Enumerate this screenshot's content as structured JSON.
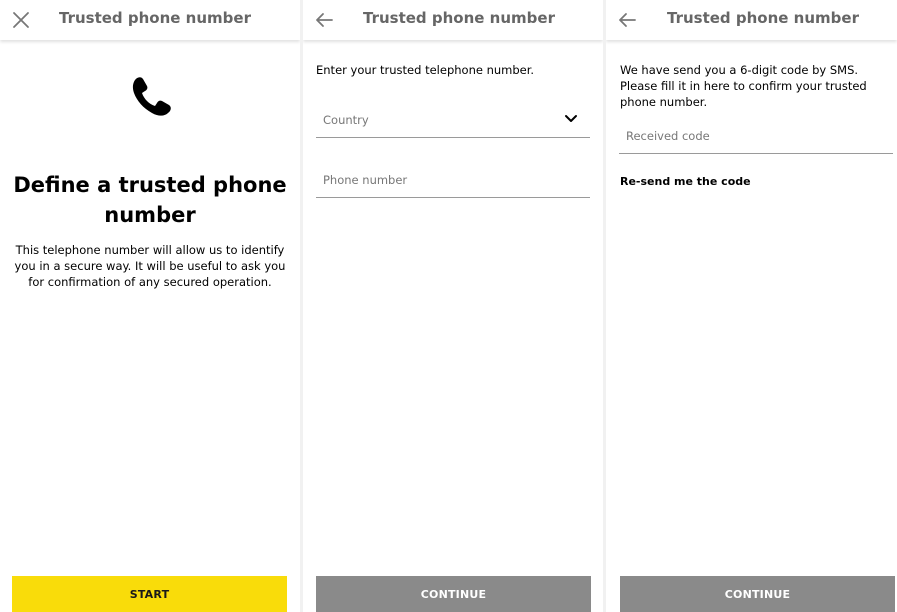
{
  "screens": {
    "intro": {
      "title": "Trusted phone number",
      "nav_icon": "close-icon",
      "hero_icon": "phone-icon",
      "headline": "Define a trusted phone number",
      "description": "This telephone number will allow us to identify you in a secure way. It will be useful to ask you for confirmation of any secured operation.",
      "button_label": "START"
    },
    "enter_number": {
      "title": "Trusted phone number",
      "nav_icon": "back-arrow-icon",
      "instruction": "Enter your trusted telephone number.",
      "country_placeholder": "Country",
      "phone_placeholder": "Phone number",
      "button_label": "CONTINUE"
    },
    "confirm_code": {
      "title": "Trusted phone number",
      "nav_icon": "back-arrow-icon",
      "instruction": "We have send you a 6-digit code by SMS. Please fill it in here to confirm your trusted phone number.",
      "code_placeholder": "Received code",
      "resend_label": "Re-send me the code",
      "button_label": "CONTINUE"
    }
  },
  "colors": {
    "primary_button": "#f9dc0a",
    "disabled_button": "#8a8a8a",
    "title_text": "#666666"
  }
}
